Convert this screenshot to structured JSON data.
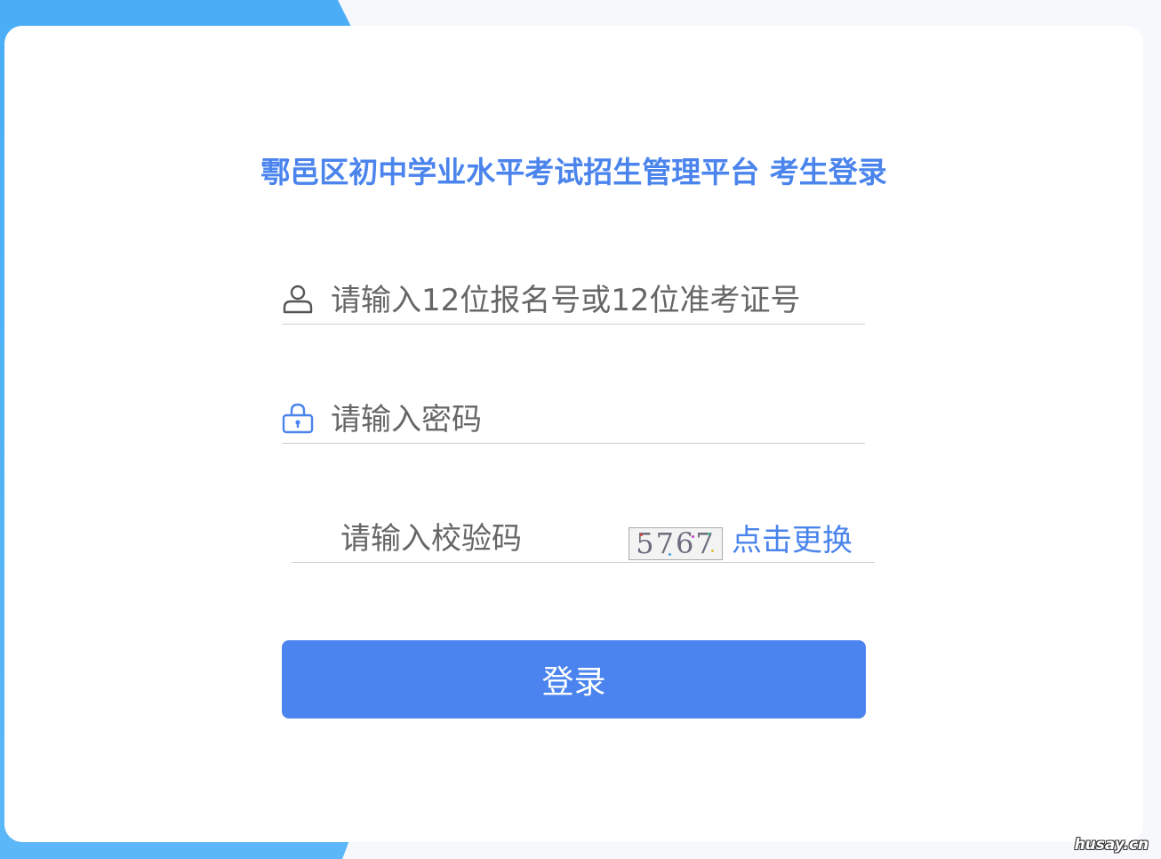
{
  "colors": {
    "accent": "#4a84ec",
    "button_bg": "#4b84ee",
    "side_band": "#4aaef6",
    "page_bg": "#f6f8fc"
  },
  "header": {
    "title": "鄠邑区初中学业水平考试招生管理平台 考生登录"
  },
  "form": {
    "username": {
      "icon": "user-icon",
      "placeholder": "请输入12位报名号或12位准考证号",
      "value": ""
    },
    "password": {
      "icon": "lock-icon",
      "placeholder": "请输入密码",
      "value": ""
    },
    "captcha": {
      "placeholder": "请输入校验码",
      "value": "",
      "image_text": "5767",
      "refresh_label": "点击更换"
    },
    "submit_label": "登录"
  },
  "watermark": "husay.cn"
}
